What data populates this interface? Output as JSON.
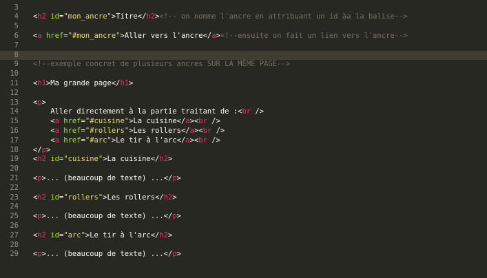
{
  "editor": {
    "colors": {
      "background": "#272822",
      "active_line": "#3e3d32",
      "gutter_text": "#8f908a",
      "tag": "#f92672",
      "attribute": "#a6e22e",
      "string": "#e6db74",
      "comment": "#75715e",
      "text": "#f8f8f2"
    },
    "active_line_number": "8",
    "lines": [
      {
        "n": "3",
        "tokens": []
      },
      {
        "n": "4",
        "tokens": [
          {
            "t": "txt",
            "v": "<"
          },
          {
            "t": "tag",
            "v": "h2"
          },
          {
            "t": "txt",
            "v": " "
          },
          {
            "t": "attr",
            "v": "id"
          },
          {
            "t": "txt",
            "v": "="
          },
          {
            "t": "str",
            "v": "\"mon_ancre\""
          },
          {
            "t": "txt",
            "v": ">Titre</"
          },
          {
            "t": "tag",
            "v": "h2"
          },
          {
            "t": "txt",
            "v": ">"
          },
          {
            "t": "cmt",
            "v": "<!-- on nomme l'ancre en attribuant un id àa la balise-->"
          }
        ]
      },
      {
        "n": "5",
        "tokens": []
      },
      {
        "n": "6",
        "tokens": [
          {
            "t": "txt",
            "v": "<"
          },
          {
            "t": "tag",
            "v": "a"
          },
          {
            "t": "txt",
            "v": " "
          },
          {
            "t": "attr",
            "v": "href"
          },
          {
            "t": "txt",
            "v": "="
          },
          {
            "t": "str",
            "v": "\"#mon_ancre\""
          },
          {
            "t": "txt",
            "v": ">Aller vers l'ancre</"
          },
          {
            "t": "tag",
            "v": "a"
          },
          {
            "t": "txt",
            "v": ">"
          },
          {
            "t": "cmt",
            "v": "<!--ensuite on fait un lien vers l'ancre-->"
          }
        ]
      },
      {
        "n": "7",
        "tokens": []
      },
      {
        "n": "8",
        "tokens": []
      },
      {
        "n": "9",
        "tokens": [
          {
            "t": "cmt",
            "v": "<!--exemple concret de plusieurs ancres SUR LA MÊME PAGE-->"
          }
        ]
      },
      {
        "n": "10",
        "tokens": []
      },
      {
        "n": "11",
        "tokens": [
          {
            "t": "txt",
            "v": "<"
          },
          {
            "t": "tag",
            "v": "h1"
          },
          {
            "t": "txt",
            "v": ">Ma grande page</"
          },
          {
            "t": "tag",
            "v": "h1"
          },
          {
            "t": "txt",
            "v": ">"
          }
        ]
      },
      {
        "n": "12",
        "tokens": []
      },
      {
        "n": "13",
        "tokens": [
          {
            "t": "txt",
            "v": "<"
          },
          {
            "t": "tag",
            "v": "p"
          },
          {
            "t": "txt",
            "v": ">"
          }
        ]
      },
      {
        "n": "14",
        "tokens": [
          {
            "t": "txt",
            "v": "    Aller directement à la partie traitant de :<"
          },
          {
            "t": "tag",
            "v": "br"
          },
          {
            "t": "txt",
            "v": " />"
          }
        ]
      },
      {
        "n": "15",
        "tokens": [
          {
            "t": "txt",
            "v": "    <"
          },
          {
            "t": "tag",
            "v": "a"
          },
          {
            "t": "txt",
            "v": " "
          },
          {
            "t": "attr",
            "v": "href"
          },
          {
            "t": "txt",
            "v": "="
          },
          {
            "t": "str",
            "v": "\"#cuisine\""
          },
          {
            "t": "txt",
            "v": ">La cuisine</"
          },
          {
            "t": "tag",
            "v": "a"
          },
          {
            "t": "txt",
            "v": "><"
          },
          {
            "t": "tag",
            "v": "br"
          },
          {
            "t": "txt",
            "v": " />"
          }
        ]
      },
      {
        "n": "16",
        "tokens": [
          {
            "t": "txt",
            "v": "    <"
          },
          {
            "t": "tag",
            "v": "a"
          },
          {
            "t": "txt",
            "v": " "
          },
          {
            "t": "attr",
            "v": "href"
          },
          {
            "t": "txt",
            "v": "="
          },
          {
            "t": "str",
            "v": "\"#rollers\""
          },
          {
            "t": "txt",
            "v": ">Les rollers</"
          },
          {
            "t": "tag",
            "v": "a"
          },
          {
            "t": "txt",
            "v": "><"
          },
          {
            "t": "tag",
            "v": "br"
          },
          {
            "t": "txt",
            "v": " />"
          }
        ]
      },
      {
        "n": "17",
        "tokens": [
          {
            "t": "txt",
            "v": "    <"
          },
          {
            "t": "tag",
            "v": "a"
          },
          {
            "t": "txt",
            "v": " "
          },
          {
            "t": "attr",
            "v": "href"
          },
          {
            "t": "txt",
            "v": "="
          },
          {
            "t": "str",
            "v": "\"#arc\""
          },
          {
            "t": "txt",
            "v": ">Le tir à l'arc</"
          },
          {
            "t": "tag",
            "v": "a"
          },
          {
            "t": "txt",
            "v": "><"
          },
          {
            "t": "tag",
            "v": "br"
          },
          {
            "t": "txt",
            "v": " />"
          }
        ]
      },
      {
        "n": "18",
        "tokens": [
          {
            "t": "txt",
            "v": "</"
          },
          {
            "t": "tag",
            "v": "p"
          },
          {
            "t": "txt",
            "v": ">"
          }
        ]
      },
      {
        "n": "19",
        "tokens": [
          {
            "t": "txt",
            "v": "<"
          },
          {
            "t": "tag",
            "v": "h2"
          },
          {
            "t": "txt",
            "v": " "
          },
          {
            "t": "attr",
            "v": "id"
          },
          {
            "t": "txt",
            "v": "="
          },
          {
            "t": "str",
            "v": "\"cuisine\""
          },
          {
            "t": "txt",
            "v": ">La cuisine</"
          },
          {
            "t": "tag",
            "v": "h2"
          },
          {
            "t": "txt",
            "v": ">"
          }
        ]
      },
      {
        "n": "20",
        "tokens": []
      },
      {
        "n": "21",
        "tokens": [
          {
            "t": "txt",
            "v": "<"
          },
          {
            "t": "tag",
            "v": "p"
          },
          {
            "t": "txt",
            "v": ">... (beaucoup de texte) ...</"
          },
          {
            "t": "tag",
            "v": "p"
          },
          {
            "t": "txt",
            "v": ">"
          }
        ]
      },
      {
        "n": "22",
        "tokens": []
      },
      {
        "n": "23",
        "tokens": [
          {
            "t": "txt",
            "v": "<"
          },
          {
            "t": "tag",
            "v": "h2"
          },
          {
            "t": "txt",
            "v": " "
          },
          {
            "t": "attr",
            "v": "id"
          },
          {
            "t": "txt",
            "v": "="
          },
          {
            "t": "str",
            "v": "\"rollers\""
          },
          {
            "t": "txt",
            "v": ">Les rollers</"
          },
          {
            "t": "tag",
            "v": "h2"
          },
          {
            "t": "txt",
            "v": ">"
          }
        ]
      },
      {
        "n": "24",
        "tokens": []
      },
      {
        "n": "25",
        "tokens": [
          {
            "t": "txt",
            "v": "<"
          },
          {
            "t": "tag",
            "v": "p"
          },
          {
            "t": "txt",
            "v": ">... (beaucoup de texte) ...</"
          },
          {
            "t": "tag",
            "v": "p"
          },
          {
            "t": "txt",
            "v": ">"
          }
        ]
      },
      {
        "n": "26",
        "tokens": []
      },
      {
        "n": "27",
        "tokens": [
          {
            "t": "txt",
            "v": "<"
          },
          {
            "t": "tag",
            "v": "h2"
          },
          {
            "t": "txt",
            "v": " "
          },
          {
            "t": "attr",
            "v": "id"
          },
          {
            "t": "txt",
            "v": "="
          },
          {
            "t": "str",
            "v": "\"arc\""
          },
          {
            "t": "txt",
            "v": ">Le tir à l'arc</"
          },
          {
            "t": "tag",
            "v": "h2"
          },
          {
            "t": "txt",
            "v": ">"
          }
        ]
      },
      {
        "n": "28",
        "tokens": []
      },
      {
        "n": "29",
        "tokens": [
          {
            "t": "txt",
            "v": "<"
          },
          {
            "t": "tag",
            "v": "p"
          },
          {
            "t": "txt",
            "v": ">... (beaucoup de texte) ...</"
          },
          {
            "t": "tag",
            "v": "p"
          },
          {
            "t": "txt",
            "v": ">"
          }
        ]
      }
    ]
  }
}
